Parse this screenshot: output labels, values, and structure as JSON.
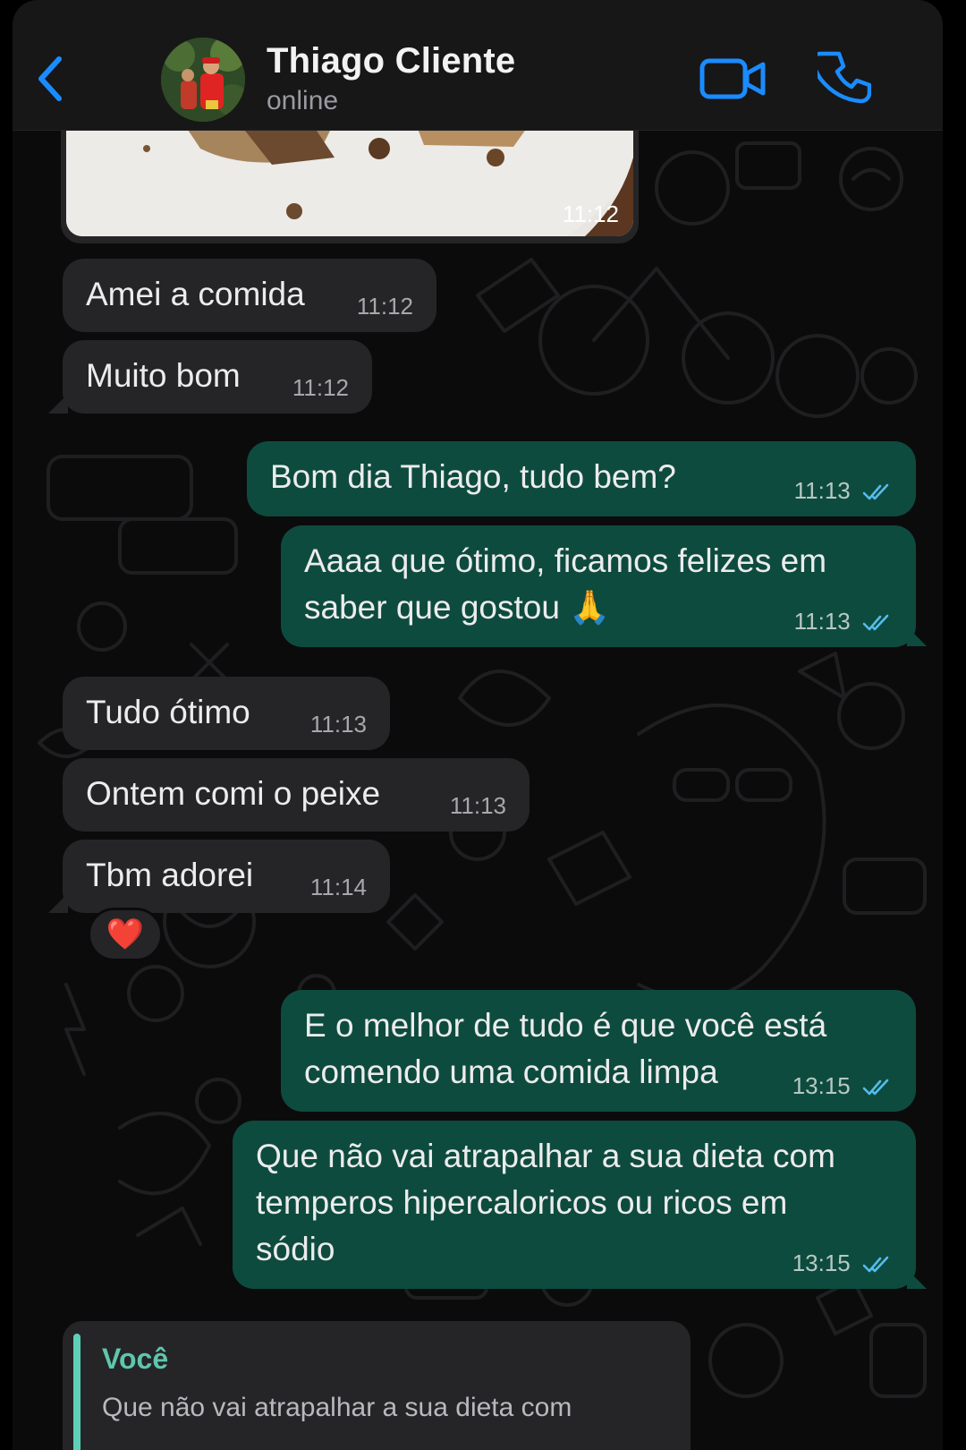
{
  "header": {
    "contact_name": "Thiago Cliente",
    "status": "online"
  },
  "messages": [
    {
      "type": "image",
      "direction": "incoming",
      "time": "11:12"
    },
    {
      "type": "text",
      "direction": "incoming",
      "text": "Amei a comida",
      "time": "11:12"
    },
    {
      "type": "text",
      "direction": "incoming",
      "text": "Muito bom",
      "time": "11:12"
    },
    {
      "type": "text",
      "direction": "outgoing",
      "text": "Bom dia Thiago, tudo bem?",
      "time": "11:13",
      "read": true
    },
    {
      "type": "text",
      "direction": "outgoing",
      "line1": "Aaaa que ótimo, ficamos felizes em",
      "line2": "saber que gostou 🙏",
      "time": "11:13",
      "read": true
    },
    {
      "type": "text",
      "direction": "incoming",
      "text": "Tudo ótimo",
      "time": "11:13"
    },
    {
      "type": "text",
      "direction": "incoming",
      "text": "Ontem comi o peixe",
      "time": "11:13"
    },
    {
      "type": "text",
      "direction": "incoming",
      "text": "Tbm adorei",
      "time": "11:14",
      "reaction": "❤️"
    },
    {
      "type": "text",
      "direction": "outgoing",
      "line1": "E o melhor de tudo é que você está",
      "line2": "comendo uma comida limpa",
      "time": "13:15",
      "read": true
    },
    {
      "type": "text",
      "direction": "outgoing",
      "line1": "Que não vai atrapalhar a sua dieta com",
      "line2": "temperos hipercaloricos ou ricos em",
      "line3": "sódio",
      "time": "13:15",
      "read": true
    }
  ],
  "reply_preview": {
    "author": "Você",
    "text": "Que não vai atrapalhar a sua dieta com"
  },
  "colors": {
    "incoming_bubble": "#252527",
    "outgoing_bubble": "#0e4b3f",
    "accent_blue": "#1a8cff",
    "read_ticks": "#53bdeb",
    "quote_accent": "#5fd0b8"
  },
  "icons": [
    "chevron-left-icon",
    "video-camera-icon",
    "phone-icon",
    "double-check-icon",
    "heart-reaction"
  ]
}
